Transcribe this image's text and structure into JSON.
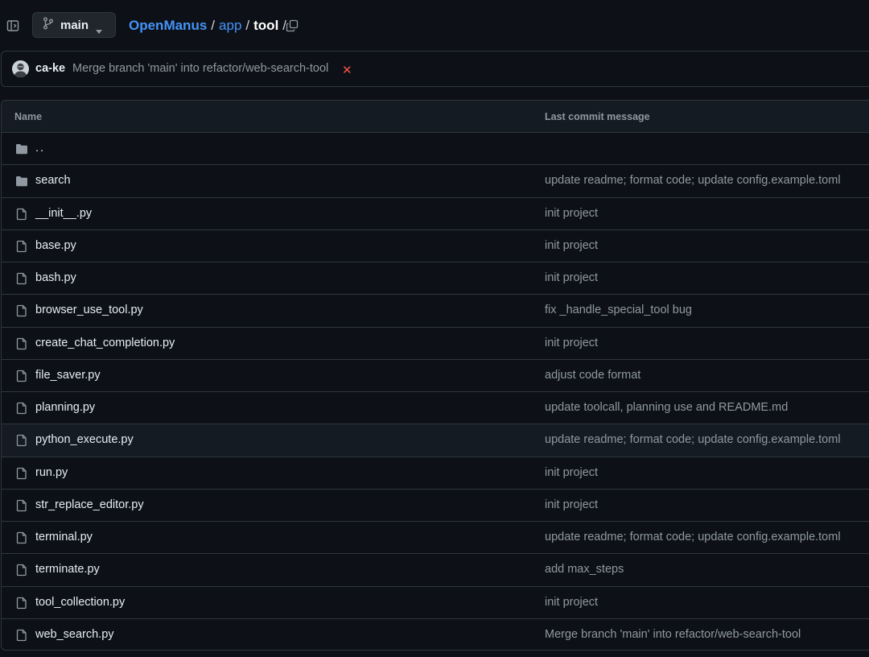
{
  "header": {
    "branch": "main",
    "breadcrumb": {
      "repo": "OpenManus",
      "folder": "app",
      "current": "tool",
      "separator": "/"
    }
  },
  "commit": {
    "author": "ca-ke",
    "message": "Merge branch 'main' into refactor/web-search-tool",
    "status": "✕"
  },
  "table": {
    "columns": {
      "name": "Name",
      "message": "Last commit message"
    },
    "rows": [
      {
        "type": "parent",
        "name": "..",
        "message": ""
      },
      {
        "type": "folder",
        "name": "search",
        "message": "update readme; format code; update config.example.toml"
      },
      {
        "type": "file",
        "name": "__init__.py",
        "message": "init project"
      },
      {
        "type": "file",
        "name": "base.py",
        "message": "init project"
      },
      {
        "type": "file",
        "name": "bash.py",
        "message": "init project"
      },
      {
        "type": "file",
        "name": "browser_use_tool.py",
        "message": "fix _handle_special_tool bug"
      },
      {
        "type": "file",
        "name": "create_chat_completion.py",
        "message": "init project"
      },
      {
        "type": "file",
        "name": "file_saver.py",
        "message": "adjust code format"
      },
      {
        "type": "file",
        "name": "planning.py",
        "message": "update toolcall, planning use and README.md"
      },
      {
        "type": "file",
        "name": "python_execute.py",
        "message": "update readme; format code; update config.example.toml"
      },
      {
        "type": "file",
        "name": "run.py",
        "message": "init project"
      },
      {
        "type": "file",
        "name": "str_replace_editor.py",
        "message": "init project"
      },
      {
        "type": "file",
        "name": "terminal.py",
        "message": "update readme; format code; update config.example.toml"
      },
      {
        "type": "file",
        "name": "terminate.py",
        "message": "add max_steps"
      },
      {
        "type": "file",
        "name": "tool_collection.py",
        "message": "init project"
      },
      {
        "type": "file",
        "name": "web_search.py",
        "message": "Merge branch 'main' into refactor/web-search-tool"
      }
    ]
  },
  "colors": {
    "background": "#0d1117",
    "border": "#30363d",
    "link": "#4493f8",
    "muted": "#9198a1",
    "error": "#f85149"
  }
}
